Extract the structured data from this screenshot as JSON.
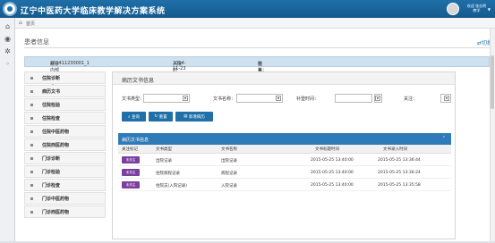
{
  "header": {
    "title": "辽宁中医药大学临床教学解决方案系统",
    "user_greeting": "欢迎 张志明",
    "user_line2": "教学"
  },
  "iconbar": {
    "icons": [
      "home-icon",
      "globe-icon",
      "gear-icon",
      "arrow-icon"
    ]
  },
  "breadcrumb": {
    "home_glyph": "⌂",
    "current": "首页"
  },
  "patient": {
    "section_title": "患者信息",
    "switch_label": "切换",
    "info": [
      {
        "label": "就诊内部序号：",
        "value": "201411230001_1"
      },
      {
        "label": "入院时间：",
        "value": "2014-11-23"
      },
      {
        "label": "姓名：",
        "value": "张某某"
      }
    ]
  },
  "nav": {
    "items": [
      "住院诊断",
      "病历文书",
      "住院检验",
      "住院检查",
      "住院中医药物",
      "住院西医药物",
      "门诊诊断",
      "门诊检验",
      "门诊检查",
      "门诊中医药物",
      "门诊西医药物"
    ]
  },
  "panel": {
    "title": "病历文书信息",
    "filters": {
      "doc_type_label": "文书类型：",
      "doc_name_label": "文书名称：",
      "time_label": "补登时间：",
      "attention_label": "关注："
    },
    "buttons": {
      "query": "查询",
      "reset": "重置",
      "add": "新增病历"
    },
    "table": {
      "title": "病历文书信息",
      "columns": [
        "关注标记",
        "文书类型",
        "文书名称",
        "文书标题时间",
        "文书录入时间"
      ],
      "rows": [
        {
          "tag": "未关注",
          "type": "出院记录",
          "name": "出院记录",
          "title_time": "2015-05-25 13:40:00",
          "entry_time": "2015-05-25 13:36:44"
        },
        {
          "tag": "未关注",
          "type": "住院病程记录",
          "name": "病程记录",
          "title_time": "2015-05-25 13:40:00",
          "entry_time": "2015-05-25 13:36:24"
        },
        {
          "tag": "未关注",
          "type": "住院志(入院记录)",
          "name": "入院记录",
          "title_time": "2015-05-25 13:40:00",
          "entry_time": "2015-05-25 13:35:58"
        }
      ]
    }
  },
  "colors": {
    "header_blue": "#1f6fa8",
    "table_head_blue": "#2f7ab9",
    "tag_purple": "#7b3fa0",
    "info_bar": "#cfe0ef"
  }
}
